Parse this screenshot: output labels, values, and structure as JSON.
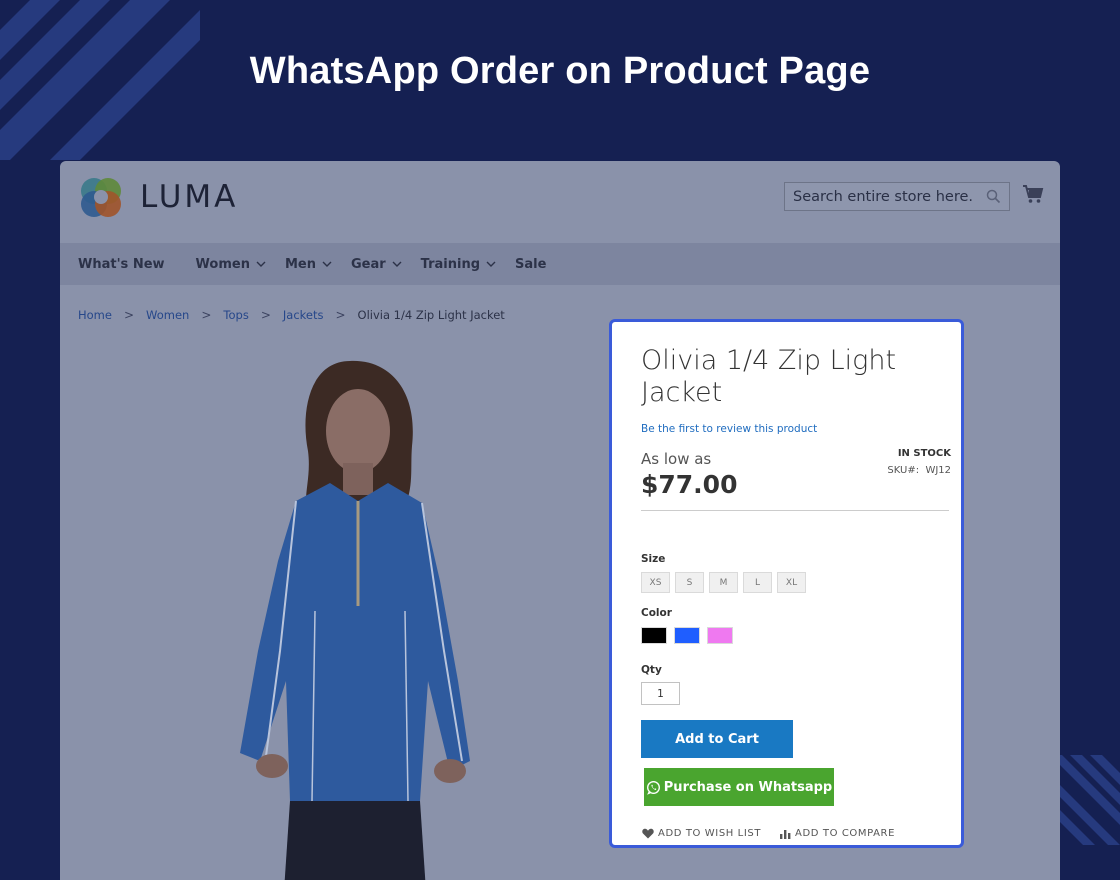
{
  "hero": {
    "title": "WhatsApp Order on Product Page"
  },
  "store": {
    "logo_text": "LUMA",
    "search_placeholder": "Search entire store here...",
    "nav": [
      "What's New",
      "Women",
      "Men",
      "Gear",
      "Training",
      "Sale"
    ],
    "breadcrumb": {
      "links": [
        "Home",
        "Women",
        "Tops",
        "Jackets"
      ],
      "current": "Olivia 1/4 Zip Light Jacket"
    }
  },
  "product": {
    "title": "Olivia 1/4 Zip Light Jacket",
    "review_link": "Be the first to review this product",
    "price_prefix": "As low as",
    "price": "$77.00",
    "stock": "IN STOCK",
    "sku_label": "SKU#:",
    "sku": "WJ12",
    "size_label": "Size",
    "sizes": [
      "XS",
      "S",
      "M",
      "L",
      "XL"
    ],
    "color_label": "Color",
    "colors": [
      "#000000",
      "#1f5eff",
      "#ef79f0"
    ],
    "qty_label": "Qty",
    "qty": "1",
    "add_to_cart": "Add to Cart",
    "whatsapp_button": "Purchase on Whatsapp",
    "wishlist": "ADD TO WISH LIST",
    "compare": "ADD TO COMPARE"
  },
  "colors": {
    "background": "#152052",
    "panel_border": "#3a5bd9",
    "cart_button": "#1979c3",
    "whatsapp_button": "#4aa52f"
  }
}
